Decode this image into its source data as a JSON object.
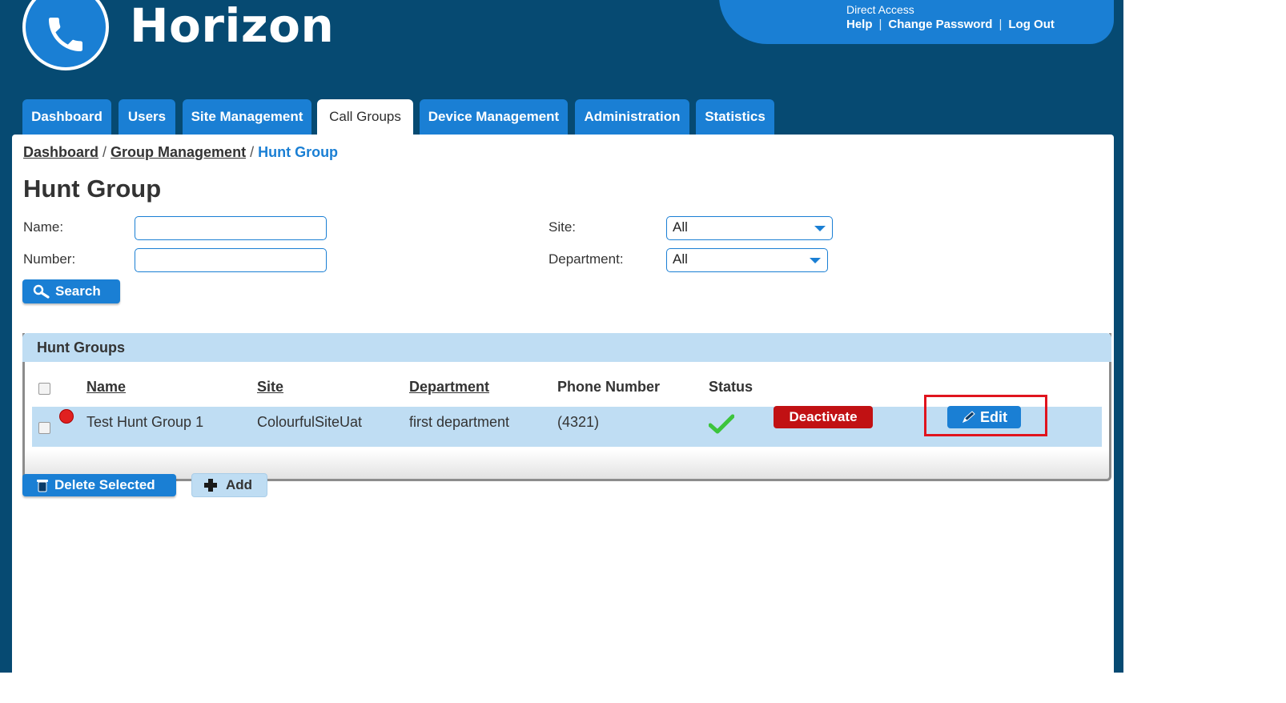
{
  "brand": {
    "name": "Horizon",
    "logo_icon": "phone-icon"
  },
  "header": {
    "direct_access": "Direct Access",
    "links": [
      "Help",
      "Change Password",
      "Log Out"
    ],
    "separator": "|"
  },
  "tabs": [
    {
      "label": "Dashboard"
    },
    {
      "label": "Users"
    },
    {
      "label": "Site Management"
    },
    {
      "label": "Call Groups",
      "active": true
    },
    {
      "label": "Device Management"
    },
    {
      "label": "Administration"
    },
    {
      "label": "Statistics"
    }
  ],
  "breadcrumb": {
    "items": [
      "Dashboard",
      "Group Management",
      "Hunt Group"
    ],
    "separator": "/"
  },
  "page_title": "Hunt Group",
  "filters": {
    "name_label": "Name:",
    "name_value": "",
    "number_label": "Number:",
    "number_value": "",
    "site_label": "Site:",
    "site_value": "All",
    "department_label": "Department:",
    "department_value": "All",
    "search_label": "Search"
  },
  "panel": {
    "title": "Hunt Groups",
    "columns": [
      "Name",
      "Site",
      "Department",
      "Phone Number",
      "Status"
    ],
    "rows": [
      {
        "name": "Test Hunt Group 1",
        "site": "ColourfulSiteUat",
        "department": "first department",
        "phone": "(4321)",
        "status_icon": "checkmark-icon",
        "deactivate_label": "Deactivate",
        "edit_label": "Edit"
      }
    ]
  },
  "actions": {
    "delete_label": "Delete Selected",
    "add_label": "Add"
  },
  "colors": {
    "primary": "#1a7fd4",
    "header_bg": "#064a72",
    "panel_bg": "#bfddf3",
    "danger": "#c11113",
    "highlight": "#e0141e",
    "success": "#3cc43c"
  }
}
